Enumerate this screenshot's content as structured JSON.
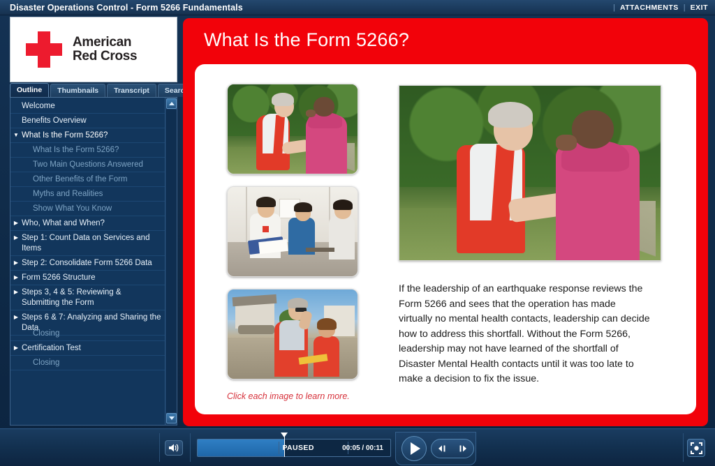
{
  "header": {
    "title": "Disaster Operations Control - Form 5266 Fundamentals",
    "separator": "|",
    "attachments_label": "ATTACHMENTS",
    "exit_label": "EXIT"
  },
  "logo": {
    "line1": "American",
    "line2": "Red Cross",
    "cross_color": "#ed1b2e"
  },
  "tabs": [
    {
      "label": "Outline",
      "active": true
    },
    {
      "label": "Thumbnails",
      "active": false
    },
    {
      "label": "Transcript",
      "active": false
    },
    {
      "label": "Search",
      "active": false
    }
  ],
  "outline": [
    {
      "label": "Welcome",
      "level": 0,
      "arrow": "",
      "expanded": false
    },
    {
      "label": "Benefits Overview",
      "level": 0,
      "arrow": "",
      "expanded": false
    },
    {
      "label": "What Is the Form 5266?",
      "level": 0,
      "arrow": "▼",
      "expanded": true
    },
    {
      "label": "What Is the Form 5266?",
      "level": 1,
      "arrow": "",
      "expanded": false
    },
    {
      "label": "Two Main Questions Answered",
      "level": 1,
      "arrow": "",
      "expanded": false
    },
    {
      "label": "Other Benefits of the Form",
      "level": 1,
      "arrow": "",
      "expanded": false
    },
    {
      "label": "Myths and Realities",
      "level": 1,
      "arrow": "",
      "expanded": false
    },
    {
      "label": "Show What You Know",
      "level": 1,
      "arrow": "",
      "expanded": false
    },
    {
      "label": "Who, What and When?",
      "level": 0,
      "arrow": "▶",
      "expanded": false
    },
    {
      "label": "Step 1: Count Data on Services and Items",
      "level": 0,
      "arrow": "▶",
      "expanded": false
    },
    {
      "label": "Step 2: Consolidate Form 5266 Data",
      "level": 0,
      "arrow": "▶",
      "expanded": false
    },
    {
      "label": "Form 5266 Structure",
      "level": 0,
      "arrow": "▶",
      "expanded": false
    },
    {
      "label": "Steps 3, 4 & 5: Reviewing & Submitting the Form",
      "level": 0,
      "arrow": "▶",
      "expanded": false
    },
    {
      "label": "Steps 6 & 7: Analyzing and Sharing the Data",
      "level": 0,
      "arrow": "▶",
      "expanded": false
    },
    {
      "label": "Closing",
      "level": 1,
      "arrow": "",
      "expanded": false
    },
    {
      "label": "Certification Test",
      "level": 0,
      "arrow": "▶",
      "expanded": false
    },
    {
      "label": "Closing",
      "level": 1,
      "arrow": "",
      "expanded": false
    }
  ],
  "slide": {
    "title": "What Is the Form 5266?",
    "accent_color": "#f2020a",
    "body": "If the leadership of an earthquake response reviews the Form 5266 and sees that the operation has made virtually no mental health contacts, leadership can decide how to address this shortfall. Without the Form 5266, leadership may not have learned of the shortfall of Disaster Mental Health contacts until it was too late to make a decision to fix the issue.",
    "caption": "Click each image to learn more.",
    "caption_color": "#d6303a",
    "thumbnails": [
      {
        "alt": "Red Cross volunteer in red vest speaking with a woman in a pink hoodie outdoors",
        "selected": true
      },
      {
        "alt": "Relief worker writing on a clipboard inside a white shelter tent with two people seated",
        "selected": false
      },
      {
        "alt": "Two Red Cross workers performing damage assessment on a street beside a damaged house",
        "selected": false
      }
    ],
    "hero": {
      "alt": "Red Cross volunteer in red vest speaking with a woman in a pink hoodie outdoors"
    }
  },
  "player": {
    "volume_icon": "speaker-icon",
    "status": "PAUSED",
    "time": "00:05 / 00:11",
    "progress_percent": 45,
    "play_label": "play",
    "prev_label": "previous",
    "next_label": "next",
    "fullscreen_label": "fullscreen"
  }
}
